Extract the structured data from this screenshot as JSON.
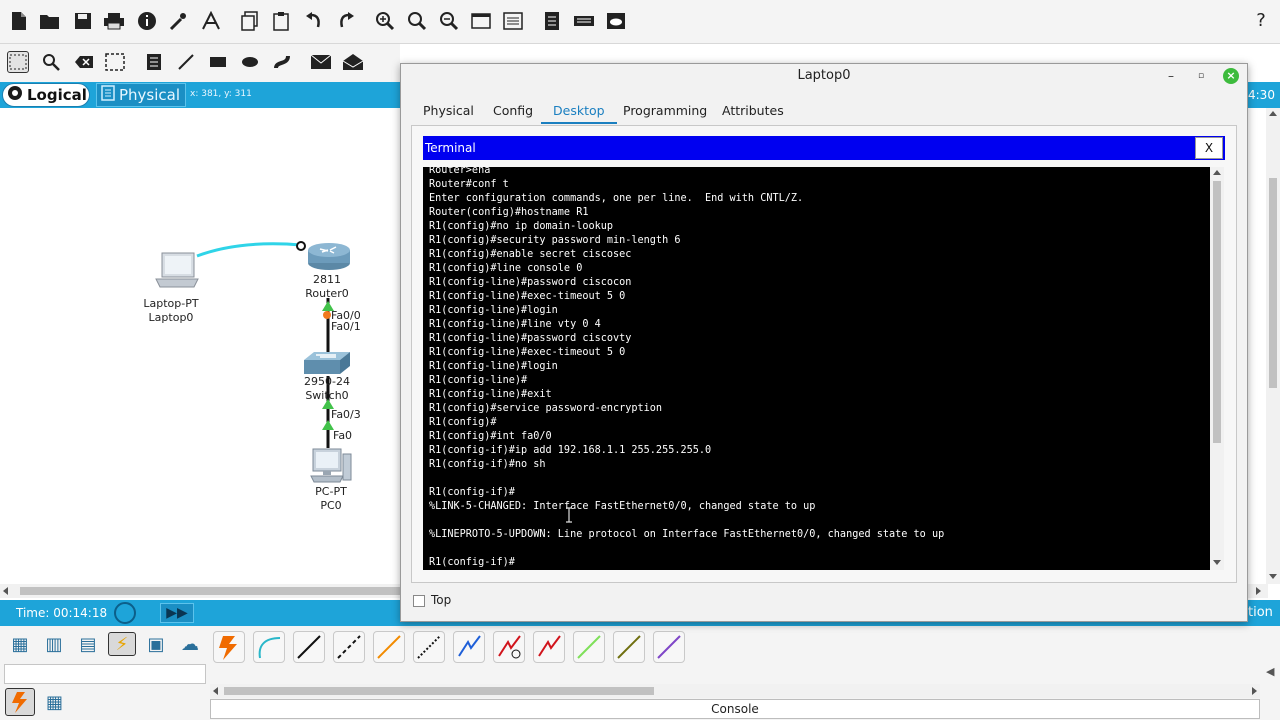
{
  "toolbar": {
    "icons": [
      "new-icon",
      "open-icon",
      "save-icon",
      "print-icon",
      "info-icon",
      "network-wizard-icon",
      "text-icon",
      "copy-icon",
      "paste-icon",
      "undo-icon",
      "redo-icon",
      "zoom-in-icon",
      "zoom-reset-icon",
      "zoom-out-icon",
      "window-icon",
      "palette-icon",
      "notes-icon",
      "device-icon",
      "cloud-icon"
    ],
    "help_label": "?"
  },
  "mode_bar": {
    "logical_label": "Logical",
    "physical_label": "Physical",
    "coords": "x: 381, y: 311",
    "clock_fragment": "4:30"
  },
  "topology": {
    "laptop": {
      "model": "Laptop-PT",
      "name": "Laptop0"
    },
    "router": {
      "model": "2811",
      "name": "Router0"
    },
    "switch": {
      "model": "2950-24",
      "name": "Switch0"
    },
    "pc": {
      "model": "PC-PT",
      "name": "PC0"
    },
    "ports": {
      "r_fa00": "Fa0/0",
      "s_fa01": "Fa0/1",
      "s_fa03": "Fa0/3",
      "pc_fa0": "Fa0"
    }
  },
  "statusbar": {
    "time": "Time: 00:14:18",
    "right_fragment": "tion"
  },
  "bottom": {
    "console_label": "Console"
  },
  "window": {
    "title": "Laptop0",
    "tabs": [
      "Physical",
      "Config",
      "Desktop",
      "Programming",
      "Attributes"
    ],
    "active_tab": "Desktop",
    "terminal_title": "Terminal",
    "terminal_close": "X",
    "top_label": "Top",
    "terminal_lines": [
      "Router>ena",
      "Router#conf t",
      "Enter configuration commands, one per line.  End with CNTL/Z.",
      "Router(config)#hostname R1",
      "R1(config)#no ip domain-lookup",
      "R1(config)#security password min-length 6",
      "R1(config)#enable secret ciscosec",
      "R1(config)#line console 0",
      "R1(config-line)#password ciscocon",
      "R1(config-line)#exec-timeout 5 0",
      "R1(config-line)#login",
      "R1(config-line)#line vty 0 4",
      "R1(config-line)#password ciscovty",
      "R1(config-line)#exec-timeout 5 0",
      "R1(config-line)#login",
      "R1(config-line)#",
      "R1(config-line)#exit",
      "R1(config)#service password-encryption",
      "R1(config)#",
      "R1(config)#int fa0/0",
      "R1(config-if)#ip add 192.168.1.1 255.255.255.0",
      "R1(config-if)#no sh",
      "",
      "R1(config-if)#",
      "%LINK-5-CHANGED: Interface FastEthernet0/0, changed state to up",
      "",
      "%LINEPROTO-5-UPDOWN: Line protocol on Interface FastEthernet0/0, changed state to up",
      "",
      "R1(config-if)#"
    ]
  }
}
